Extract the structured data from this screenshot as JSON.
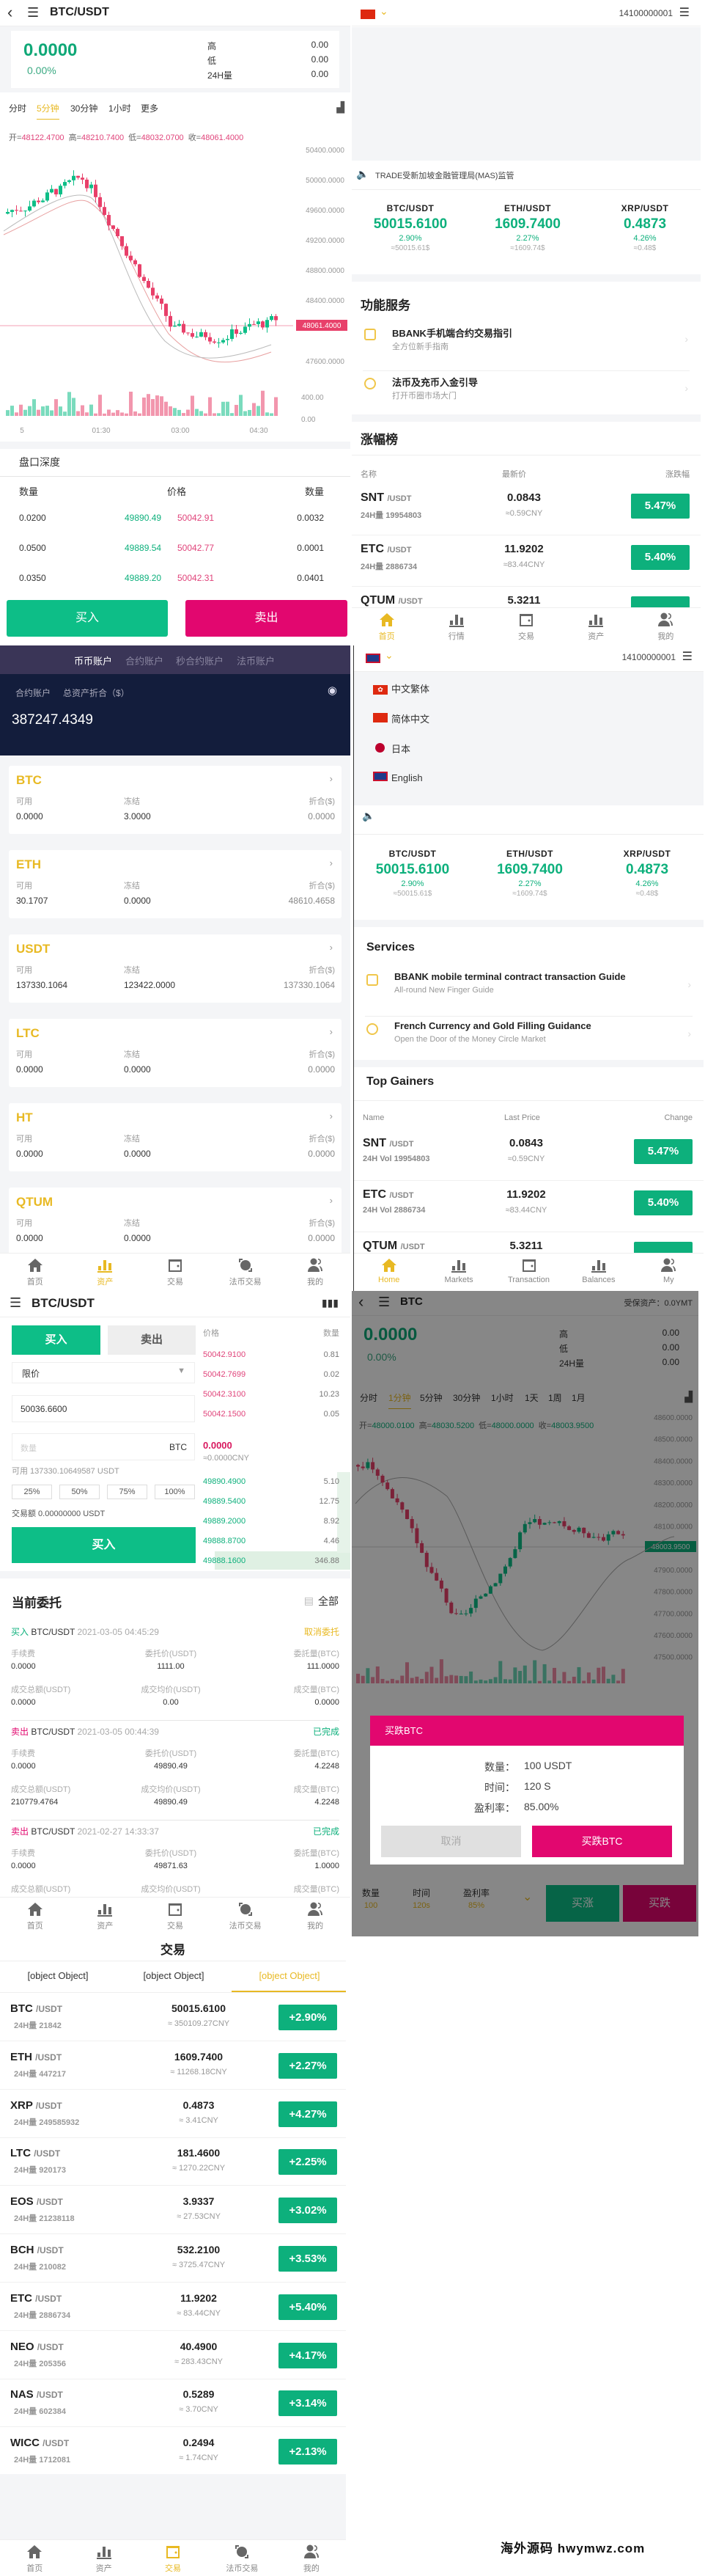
{
  "colors": {
    "green": "#0db07c",
    "pink": "#e2076f",
    "yellow": "#e8b923",
    "red": "#e8406a",
    "navy": "#131d3c",
    "purple": "#3a3557"
  },
  "kline": {
    "title": "BTC/USDT",
    "price": "0.0000",
    "change": "0.00%",
    "stats": [
      {
        "label": "高",
        "value": "0.00"
      },
      {
        "label": "低",
        "value": "0.00"
      },
      {
        "label": "24H量",
        "value": "0.00"
      }
    ],
    "periods": [
      "分时",
      "5分钟",
      "30分钟",
      "1小时",
      "更多"
    ],
    "active_period": 1,
    "ohlc": [
      {
        "label": "开=",
        "value": "48122.4700"
      },
      {
        "label": "高=",
        "value": "48210.7400"
      },
      {
        "label": "低=",
        "value": "48032.0700"
      },
      {
        "label": "收=",
        "value": "48061.4000"
      }
    ],
    "y_axis": [
      "50400.0000",
      "50000.0000",
      "49600.0000",
      "49200.0000",
      "48800.0000",
      "48400.0000",
      "47600.0000"
    ],
    "current_price": "48061.4000",
    "vol_axis": [
      "400.00",
      "0.00"
    ],
    "time_axis": [
      "5",
      "01:30",
      "03:00",
      "04:30"
    ],
    "depth_title": "盘口深度",
    "depth_headers": [
      "数量",
      "价格",
      "数量"
    ],
    "depth_rows": [
      {
        "bid_qty": "0.0200",
        "bid_price": "49890.49",
        "ask_price": "50042.91",
        "ask_qty": "0.0032"
      },
      {
        "bid_qty": "0.0500",
        "bid_price": "49889.54",
        "ask_price": "50042.77",
        "ask_qty": "0.0001"
      },
      {
        "bid_qty": "0.0350",
        "bid_price": "49889.20",
        "ask_price": "50042.31",
        "ask_qty": "0.0401"
      }
    ],
    "buy": "买入",
    "sell": "卖出"
  },
  "home_cn": {
    "phone": "14100000001",
    "notice": "TRADE受新加坡金融管理局(MAS)监管",
    "tickers": [
      {
        "pair": "BTC/USDT",
        "price": "50015.6100",
        "change": "2.90%",
        "usd": "≈50015.61$"
      },
      {
        "pair": "ETH/USDT",
        "price": "1609.7400",
        "change": "2.27%",
        "usd": "≈1609.74$"
      },
      {
        "pair": "XRP/USDT",
        "price": "0.4873",
        "change": "4.26%",
        "usd": "≈0.48$"
      }
    ],
    "services_title": "功能服务",
    "services": [
      {
        "title": "BBANK手机端合约交易指引",
        "sub": "全方位新手指南"
      },
      {
        "title": "法币及充币入金引导",
        "sub": "打开币圈市场大门"
      }
    ],
    "gainers_title": "涨幅榜",
    "gainers_headers": [
      "名称",
      "最新价",
      "涨跌幅"
    ],
    "gainers": [
      {
        "coin": "SNT",
        "quote": "/USDT",
        "vol": "24H量 19954803",
        "price": "0.0843",
        "cny": "≈0.59CNY",
        "change": "5.47%"
      },
      {
        "coin": "ETC",
        "quote": "/USDT",
        "vol": "24H量 2886734",
        "price": "11.9202",
        "cny": "≈83.44CNY",
        "change": "5.40%"
      },
      {
        "coin": "QTUM",
        "quote": "/USDT",
        "vol": "",
        "price": "5.3211",
        "cny": "",
        "change": ""
      }
    ],
    "tabs": [
      {
        "label": "首页",
        "icon": "home"
      },
      {
        "label": "行情",
        "icon": "bars"
      },
      {
        "label": "交易",
        "icon": "wallet"
      },
      {
        "label": "资产",
        "icon": "bars"
      },
      {
        "label": "我的",
        "icon": "user"
      }
    ],
    "active_tab": 0
  },
  "assets": {
    "tabs": [
      "币币账户",
      "合约账户",
      "秒合约账户",
      "法币账户"
    ],
    "active_tab": 0,
    "account_label": "合约账户",
    "total_label": "总资产折合（$）",
    "total": "387247.4349",
    "col_labels": [
      "可用",
      "冻结",
      "折合($)"
    ],
    "coins": [
      {
        "name": "BTC",
        "avail": "0.0000",
        "frozen": "3.0000",
        "value": "0.0000"
      },
      {
        "name": "ETH",
        "avail": "30.1707",
        "frozen": "0.0000",
        "value": "48610.4658"
      },
      {
        "name": "USDT",
        "avail": "137330.1064",
        "frozen": "123422.0000",
        "value": "137330.1064"
      },
      {
        "name": "LTC",
        "avail": "0.0000",
        "frozen": "0.0000",
        "value": "0.0000"
      },
      {
        "name": "HT",
        "avail": "0.0000",
        "frozen": "0.0000",
        "value": "0.0000"
      },
      {
        "name": "QTUM",
        "avail": "0.0000",
        "frozen": "0.0000",
        "value": "0.0000"
      }
    ],
    "tabs_bottom": [
      {
        "label": "首页",
        "icon": "home"
      },
      {
        "label": "资产",
        "icon": "bars"
      },
      {
        "label": "交易",
        "icon": "wallet"
      },
      {
        "label": "法币交易",
        "icon": "globe"
      },
      {
        "label": "我的",
        "icon": "user"
      }
    ],
    "active_bottom": 1
  },
  "home_en": {
    "phone": "14100000001",
    "languages": [
      {
        "label": "中文繁体",
        "flag": "hk"
      },
      {
        "label": "简体中文",
        "flag": "cn"
      },
      {
        "label": "日本",
        "flag": "jp"
      },
      {
        "label": "English",
        "flag": "uk"
      }
    ],
    "tickers": [
      {
        "pair": "BTC/USDT",
        "price": "50015.6100",
        "change": "2.90%",
        "usd": "≈50015.61$"
      },
      {
        "pair": "ETH/USDT",
        "price": "1609.7400",
        "change": "2.27%",
        "usd": "≈1609.74$"
      },
      {
        "pair": "XRP/USDT",
        "price": "0.4873",
        "change": "4.26%",
        "usd": "≈0.48$"
      }
    ],
    "services_title": "Services",
    "services": [
      {
        "title": "BBANK mobile terminal contract transaction Guide",
        "sub": "All-round New Finger Guide"
      },
      {
        "title": "French Currency and Gold Filling Guidance",
        "sub": "Open the Door of the Money Circle Market"
      }
    ],
    "gainers_title": "Top Gainers",
    "gainers_headers": [
      "Name",
      "Last Price",
      "Change"
    ],
    "gainers": [
      {
        "coin": "SNT",
        "quote": "/USDT",
        "vol": "24H Vol 19954803",
        "price": "0.0843",
        "cny": "≈0.59CNY",
        "change": "5.47%"
      },
      {
        "coin": "ETC",
        "quote": "/USDT",
        "vol": "24H Vol 2886734",
        "price": "11.9202",
        "cny": "≈83.44CNY",
        "change": "5.40%"
      },
      {
        "coin": "QTUM",
        "quote": "/USDT",
        "vol": "",
        "price": "5.3211",
        "cny": "",
        "change": ""
      }
    ],
    "tabs": [
      {
        "label": "Home",
        "icon": "home"
      },
      {
        "label": "Markets",
        "icon": "bars"
      },
      {
        "label": "Transaction",
        "icon": "wallet"
      },
      {
        "label": "Balances",
        "icon": "bars"
      },
      {
        "label": "My",
        "icon": "user"
      }
    ],
    "active_tab": 0
  },
  "spot": {
    "title": "BTC/USDT",
    "buy_tab": "买入",
    "sell_tab": "卖出",
    "order_type": "限价",
    "price_value": "50036.6600",
    "qty_placeholder": "数量",
    "qty_unit": "BTC",
    "available": "可用 137330.10649587 USDT",
    "pcts": [
      "25%",
      "50%",
      "75%",
      "100%"
    ],
    "amount": "交易额 0.00000000 USDT",
    "buy_button": "买入",
    "book_headers": [
      "价格",
      "数量"
    ],
    "asks": [
      {
        "price": "50042.9100",
        "qty": "0.81"
      },
      {
        "price": "50042.7699",
        "qty": "0.02"
      },
      {
        "price": "50042.3100",
        "qty": "10.23"
      },
      {
        "price": "50042.1500",
        "qty": "0.05"
      }
    ],
    "mid_price": "0.0000",
    "mid_cny": "≈0.0000CNY",
    "bids": [
      {
        "price": "49890.4900",
        "qty": "5.10"
      },
      {
        "price": "49889.5400",
        "qty": "12.75"
      },
      {
        "price": "49889.2000",
        "qty": "8.92"
      },
      {
        "price": "49888.8700",
        "qty": "4.46"
      },
      {
        "price": "49888.1600",
        "qty": "346.88"
      }
    ],
    "orders_title": "当前委托",
    "all": "全部",
    "orders": [
      {
        "side": "买入",
        "side_color": "#0db07c",
        "pair": "BTC/USDT",
        "time": "2021-03-05 04:45:29",
        "status": "取消委托",
        "status_color": "#e8b923",
        "fields": [
          {
            "label": "手续费",
            "value": "0.0000"
          },
          {
            "label": "委托价(USDT)",
            "value": "1111.00"
          },
          {
            "label": "委託量(BTC)",
            "value": "111.0000"
          },
          {
            "label": "成交总额(USDT)",
            "value": "0.0000"
          },
          {
            "label": "成交均价(USDT)",
            "value": "0.00"
          },
          {
            "label": "成交量(BTC)",
            "value": "0.0000"
          }
        ]
      },
      {
        "side": "卖出",
        "side_color": "#e2076f",
        "pair": "BTC/USDT",
        "time": "2021-03-05 00:44:39",
        "status": "已完成",
        "status_color": "#0db07c",
        "fields": [
          {
            "label": "手续费",
            "value": "0.0000"
          },
          {
            "label": "委托价(USDT)",
            "value": "49890.49"
          },
          {
            "label": "委託量(BTC)",
            "value": "4.2248"
          },
          {
            "label": "成交总额(USDT)",
            "value": "210779.4764"
          },
          {
            "label": "成交均价(USDT)",
            "value": "49890.49"
          },
          {
            "label": "成交量(BTC)",
            "value": "4.2248"
          }
        ]
      },
      {
        "side": "卖出",
        "side_color": "#e2076f",
        "pair": "BTC/USDT",
        "time": "2021-02-27 14:33:37",
        "status": "已完成",
        "status_color": "#0db07c",
        "fields": [
          {
            "label": "手续费",
            "value": "0.0000"
          },
          {
            "label": "委托价(USDT)",
            "value": "49871.63"
          },
          {
            "label": "委託量(BTC)",
            "value": "1.0000"
          },
          {
            "label": "成交总额(USDT)",
            "value": ""
          },
          {
            "label": "成交均价(USDT)",
            "value": ""
          },
          {
            "label": "成交量(BTC)",
            "value": ""
          }
        ]
      }
    ],
    "tabs": [
      {
        "label": "首页",
        "icon": "home"
      },
      {
        "label": "资产",
        "icon": "bars"
      },
      {
        "label": "交易",
        "icon": "wallet"
      },
      {
        "label": "法币交易",
        "icon": "globe"
      },
      {
        "label": "我的",
        "icon": "user"
      }
    ],
    "active_tab": -1
  },
  "contract": {
    "title": "BTC",
    "insured": "受保资产：0.0YMT",
    "price": "0.0000",
    "change": "0.00%",
    "stats": [
      {
        "label": "高",
        "value": "0.00"
      },
      {
        "label": "低",
        "value": "0.00"
      },
      {
        "label": "24H量",
        "value": "0.00"
      }
    ],
    "periods": [
      "分时",
      "1分钟",
      "5分钟",
      "30分钟",
      "1小时",
      "1天",
      "1周",
      "1月"
    ],
    "active_period": 1,
    "ohlc": [
      {
        "label": "开=",
        "value": "48000.0100"
      },
      {
        "label": "高=",
        "value": "48030.5200"
      },
      {
        "label": "低=",
        "value": "48000.0000"
      },
      {
        "label": "收=",
        "value": "48003.9500"
      }
    ],
    "y_axis": [
      "48600.0000",
      "48500.0000",
      "48400.0000",
      "48300.0000",
      "48200.0000",
      "48100.0000",
      "47900.0000",
      "47800.0000",
      "47700.0000",
      "47600.0000",
      "47500.0000"
    ],
    "current_price": "48003.9500",
    "vol_axis": [
      "50.00",
      "0.00"
    ],
    "modal": {
      "title": "买跌BTC",
      "rows": [
        {
          "label": "数量：",
          "value": "100 USDT"
        },
        {
          "label": "时间：",
          "value": "120 S"
        },
        {
          "label": "盈利率：",
          "value": "85.00%"
        }
      ],
      "cancel": "取消",
      "confirm": "买跌BTC"
    },
    "bottom": [
      {
        "label": "数量",
        "value": "100"
      },
      {
        "label": "时间",
        "value": "120s"
      },
      {
        "label": "盈利率",
        "value": "85%"
      }
    ],
    "buy_up": "买涨",
    "buy_down": "买跌"
  },
  "markets": {
    "title": "交易",
    "tabs": [
      {
        "label": "首页",
        "icon": "home"
      },
      {
        "label": "资产",
        "icon": "bars"
      },
      {
        "label": "交易",
        "icon": "wallet"
      },
      {
        "label": "法币交易",
        "icon": "globe"
      },
      {
        "label": "我的",
        "icon": "user"
      }
    ],
    "active_tab": 2,
    "rows": [
      {
        "coin": "BTC",
        "quote": "/USDT",
        "vol": "24H量  21842",
        "price": "50015.6100",
        "cny": "≈ 350109.27CNY",
        "change": "+2.90%"
      },
      {
        "coin": "ETH",
        "quote": "/USDT",
        "vol": "24H量  447217",
        "price": "1609.7400",
        "cny": "≈ 11268.18CNY",
        "change": "+2.27%"
      },
      {
        "coin": "XRP",
        "quote": "/USDT",
        "vol": "24H量  249585932",
        "price": "0.4873",
        "cny": "≈ 3.41CNY",
        "change": "+4.27%"
      },
      {
        "coin": "LTC",
        "quote": "/USDT",
        "vol": "24H量  920173",
        "price": "181.4600",
        "cny": "≈ 1270.22CNY",
        "change": "+2.25%"
      },
      {
        "coin": "EOS",
        "quote": "/USDT",
        "vol": "24H量  21238118",
        "price": "3.9337",
        "cny": "≈ 27.53CNY",
        "change": "+3.02%"
      },
      {
        "coin": "BCH",
        "quote": "/USDT",
        "vol": "24H量  210082",
        "price": "532.2100",
        "cny": "≈ 3725.47CNY",
        "change": "+3.53%"
      },
      {
        "coin": "ETC",
        "quote": "/USDT",
        "vol": "24H量  2886734",
        "price": "11.9202",
        "cny": "≈ 83.44CNY",
        "change": "+5.40%"
      },
      {
        "coin": "NEO",
        "quote": "/USDT",
        "vol": "24H量  205356",
        "price": "40.4900",
        "cny": "≈ 283.43CNY",
        "change": "+4.17%"
      },
      {
        "coin": "NAS",
        "quote": "/USDT",
        "vol": "24H量  602384",
        "price": "0.5289",
        "cny": "≈ 3.70CNY",
        "change": "+3.14%"
      },
      {
        "coin": "WICC",
        "quote": "/USDT",
        "vol": "24H量  1712081",
        "price": "0.2494",
        "cny": "≈ 1.74CNY",
        "change": "+2.13%"
      }
    ]
  },
  "watermark": "海外源码 hwymwz.com"
}
